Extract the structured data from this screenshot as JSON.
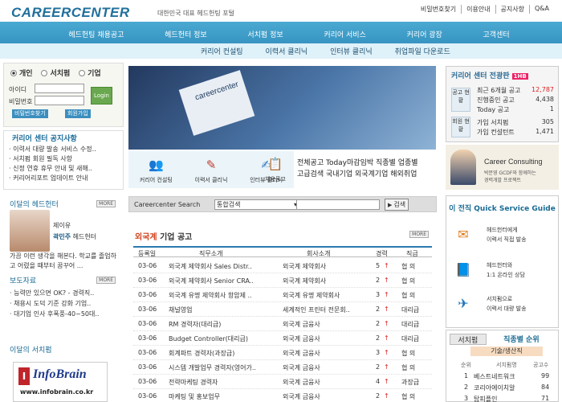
{
  "header": {
    "logo": "CAREERCENTER",
    "tagline": "대한민국 대표 헤드헌팅 포털",
    "top_links": [
      "비밀번호찾기",
      "이용안내",
      "공지사항",
      "Q&A"
    ]
  },
  "nav": {
    "main": [
      "헤드헌팅 채용공고",
      "헤드헌터 정보",
      "서치펌 정보",
      "커리어 서비스",
      "커리어 광장",
      "고객센터"
    ],
    "sub": [
      "커리어 컨설팅",
      "이력서 클리닉",
      "인터뷰 클리닉",
      "취업파일 다운로드"
    ]
  },
  "login": {
    "types": [
      "개인",
      "서치펌",
      "기업"
    ],
    "id_label": "아이디",
    "pw_label": "비밀번호",
    "login_button": "Login",
    "find_pw": "비밀번호찾기",
    "join": "회원가입"
  },
  "notice": {
    "title": "커리어 센터 공지사항",
    "items": [
      "· 이력서 대량 발송 서비스 수정..",
      "· 서치펌 회원 필독 사항",
      "· 신정 연휴 휴무 안내 및 새해..",
      "· 커리어리포트 업데이트 안내"
    ]
  },
  "banner": {
    "text": "careercenter"
  },
  "quick_icons": [
    {
      "label": "커리어 컨설팅",
      "icon": "consult-icon"
    },
    {
      "label": "이력서 클리닉",
      "icon": "resume-icon"
    },
    {
      "label": "인터뷰 클리닉",
      "icon": "interview-icon"
    },
    {
      "label": "채용공고",
      "icon": "job-icon"
    }
  ],
  "search_text": {
    "line1": "전체공고 Today마감임박 직종별 업종별",
    "line2": "고급검색 국내기업 외국계기업 해외취업"
  },
  "stats": {
    "title": "커리어 센터 전광판",
    "tag": "1HB",
    "group1_label": "공고 현황",
    "group2_label": "회원 현황",
    "rows": [
      {
        "label": "최근 6개월 공고",
        "value": "12,787"
      },
      {
        "label": "진행중인 공고",
        "value": "4,438"
      },
      {
        "label": "Today 공고",
        "value": "1"
      },
      {
        "label": "가입 서치펌",
        "value": "305"
      },
      {
        "label": "가입 컨설턴트",
        "value": "1,471"
      }
    ]
  },
  "consult": {
    "title": "Career Consulting",
    "line1": "박문영 GCDF와 함께하는",
    "line2": "경력개발 프로젝트"
  },
  "hunter": {
    "title": "이달의 헤드헌터",
    "more": "MORE",
    "company": "제이유",
    "name": "곽민주",
    "role": "헤드헌터",
    "desc": "가끔 이런 생각을 해본다. 학교를 졸업하고 어렸을 때부터 꿈꾸어 ..."
  },
  "press": {
    "title": "보도자료",
    "more": "MORE",
    "items": [
      "· 능력만 있으면 OK? - 경력직..",
      "· 채용시 도덕 기준 강화 기업..",
      "· 대기업 인사 후폭풍-40~50대.."
    ]
  },
  "search_firm": {
    "title": "이달의 서치펌",
    "logo": "InfoBrain",
    "url": "www.infobrain.co.kr"
  },
  "main_search": {
    "label": "Careercenter Search",
    "select": "통합검색",
    "button": "검색"
  },
  "jobs": {
    "title_red": "외국계",
    "title_rest": " 기업 공고",
    "more": "MORE",
    "columns": [
      "등록일",
      "직무소개",
      "회사소개",
      "경력",
      "직급"
    ],
    "rows": [
      {
        "date": "03-06",
        "job": "외국계 제약회사 Sales Distr..",
        "company": "외국계 제약회사",
        "exp": "5",
        "level": "협  의"
      },
      {
        "date": "03-06",
        "job": "외국계 제약회사 Senior CRA..",
        "company": "외국계 제약회사",
        "exp": "2",
        "level": "협  의"
      },
      {
        "date": "03-06",
        "job": "외국계 유명 제약회사 항암제 ..",
        "company": "외국계 유명 제약회사",
        "exp": "3",
        "level": "협  의"
      },
      {
        "date": "03-06",
        "job": "채널영업",
        "company": "세계적인 프린터 전문회..",
        "exp": "2",
        "level": "대리급"
      },
      {
        "date": "03-06",
        "job": "RM 경력자(대리급)",
        "company": "외국계 금융사",
        "exp": "2",
        "level": "대리급"
      },
      {
        "date": "03-06",
        "job": "Budget Controller(대리급)",
        "company": "외국계 금융사",
        "exp": "2",
        "level": "대리급"
      },
      {
        "date": "03-06",
        "job": "회계파트 경력자(과장급)",
        "company": "외국계 금융사",
        "exp": "3",
        "level": "협  의"
      },
      {
        "date": "03-06",
        "job": "시스템 개발업무 경력자(영어가..",
        "company": "외국계 금융사",
        "exp": "2",
        "level": "협  의"
      },
      {
        "date": "03-06",
        "job": "전략마케팅 경력자",
        "company": "외국계 금융사",
        "exp": "4",
        "level": "과장급"
      },
      {
        "date": "03-06",
        "job": "마케팅 및 홍보업무",
        "company": "외국계 금융사",
        "exp": "2",
        "level": "협  의"
      }
    ]
  },
  "quick_service": {
    "title": "이 전직 Quick Service Guide",
    "items": [
      {
        "line1": "헤드헌터에게",
        "line2": "이력서 직접 발송",
        "icon": "mail-icon"
      },
      {
        "line1": "헤드헌터와",
        "line2": "1:1 온라인 상담",
        "icon": "book-icon"
      },
      {
        "line1": "서치펌으로",
        "line2": "이력서 대량 발송",
        "icon": "send-icon"
      }
    ]
  },
  "rank": {
    "tab1": "서치펌",
    "tab2": "직종별 순위",
    "sub": "기술/생산직",
    "columns": [
      "순위",
      "서치펌명",
      "공고수"
    ],
    "rows": [
      {
        "rank": "1",
        "name": "베스트네트워크",
        "count": "99"
      },
      {
        "rank": "2",
        "name": "코리아에이치알",
        "count": "84"
      },
      {
        "rank": "3",
        "name": "탑피플인",
        "count": "71"
      }
    ]
  },
  "colors": {
    "brand": "#1f6f9c",
    "nav": "#2a86b8",
    "accent_red": "#d0421d"
  }
}
